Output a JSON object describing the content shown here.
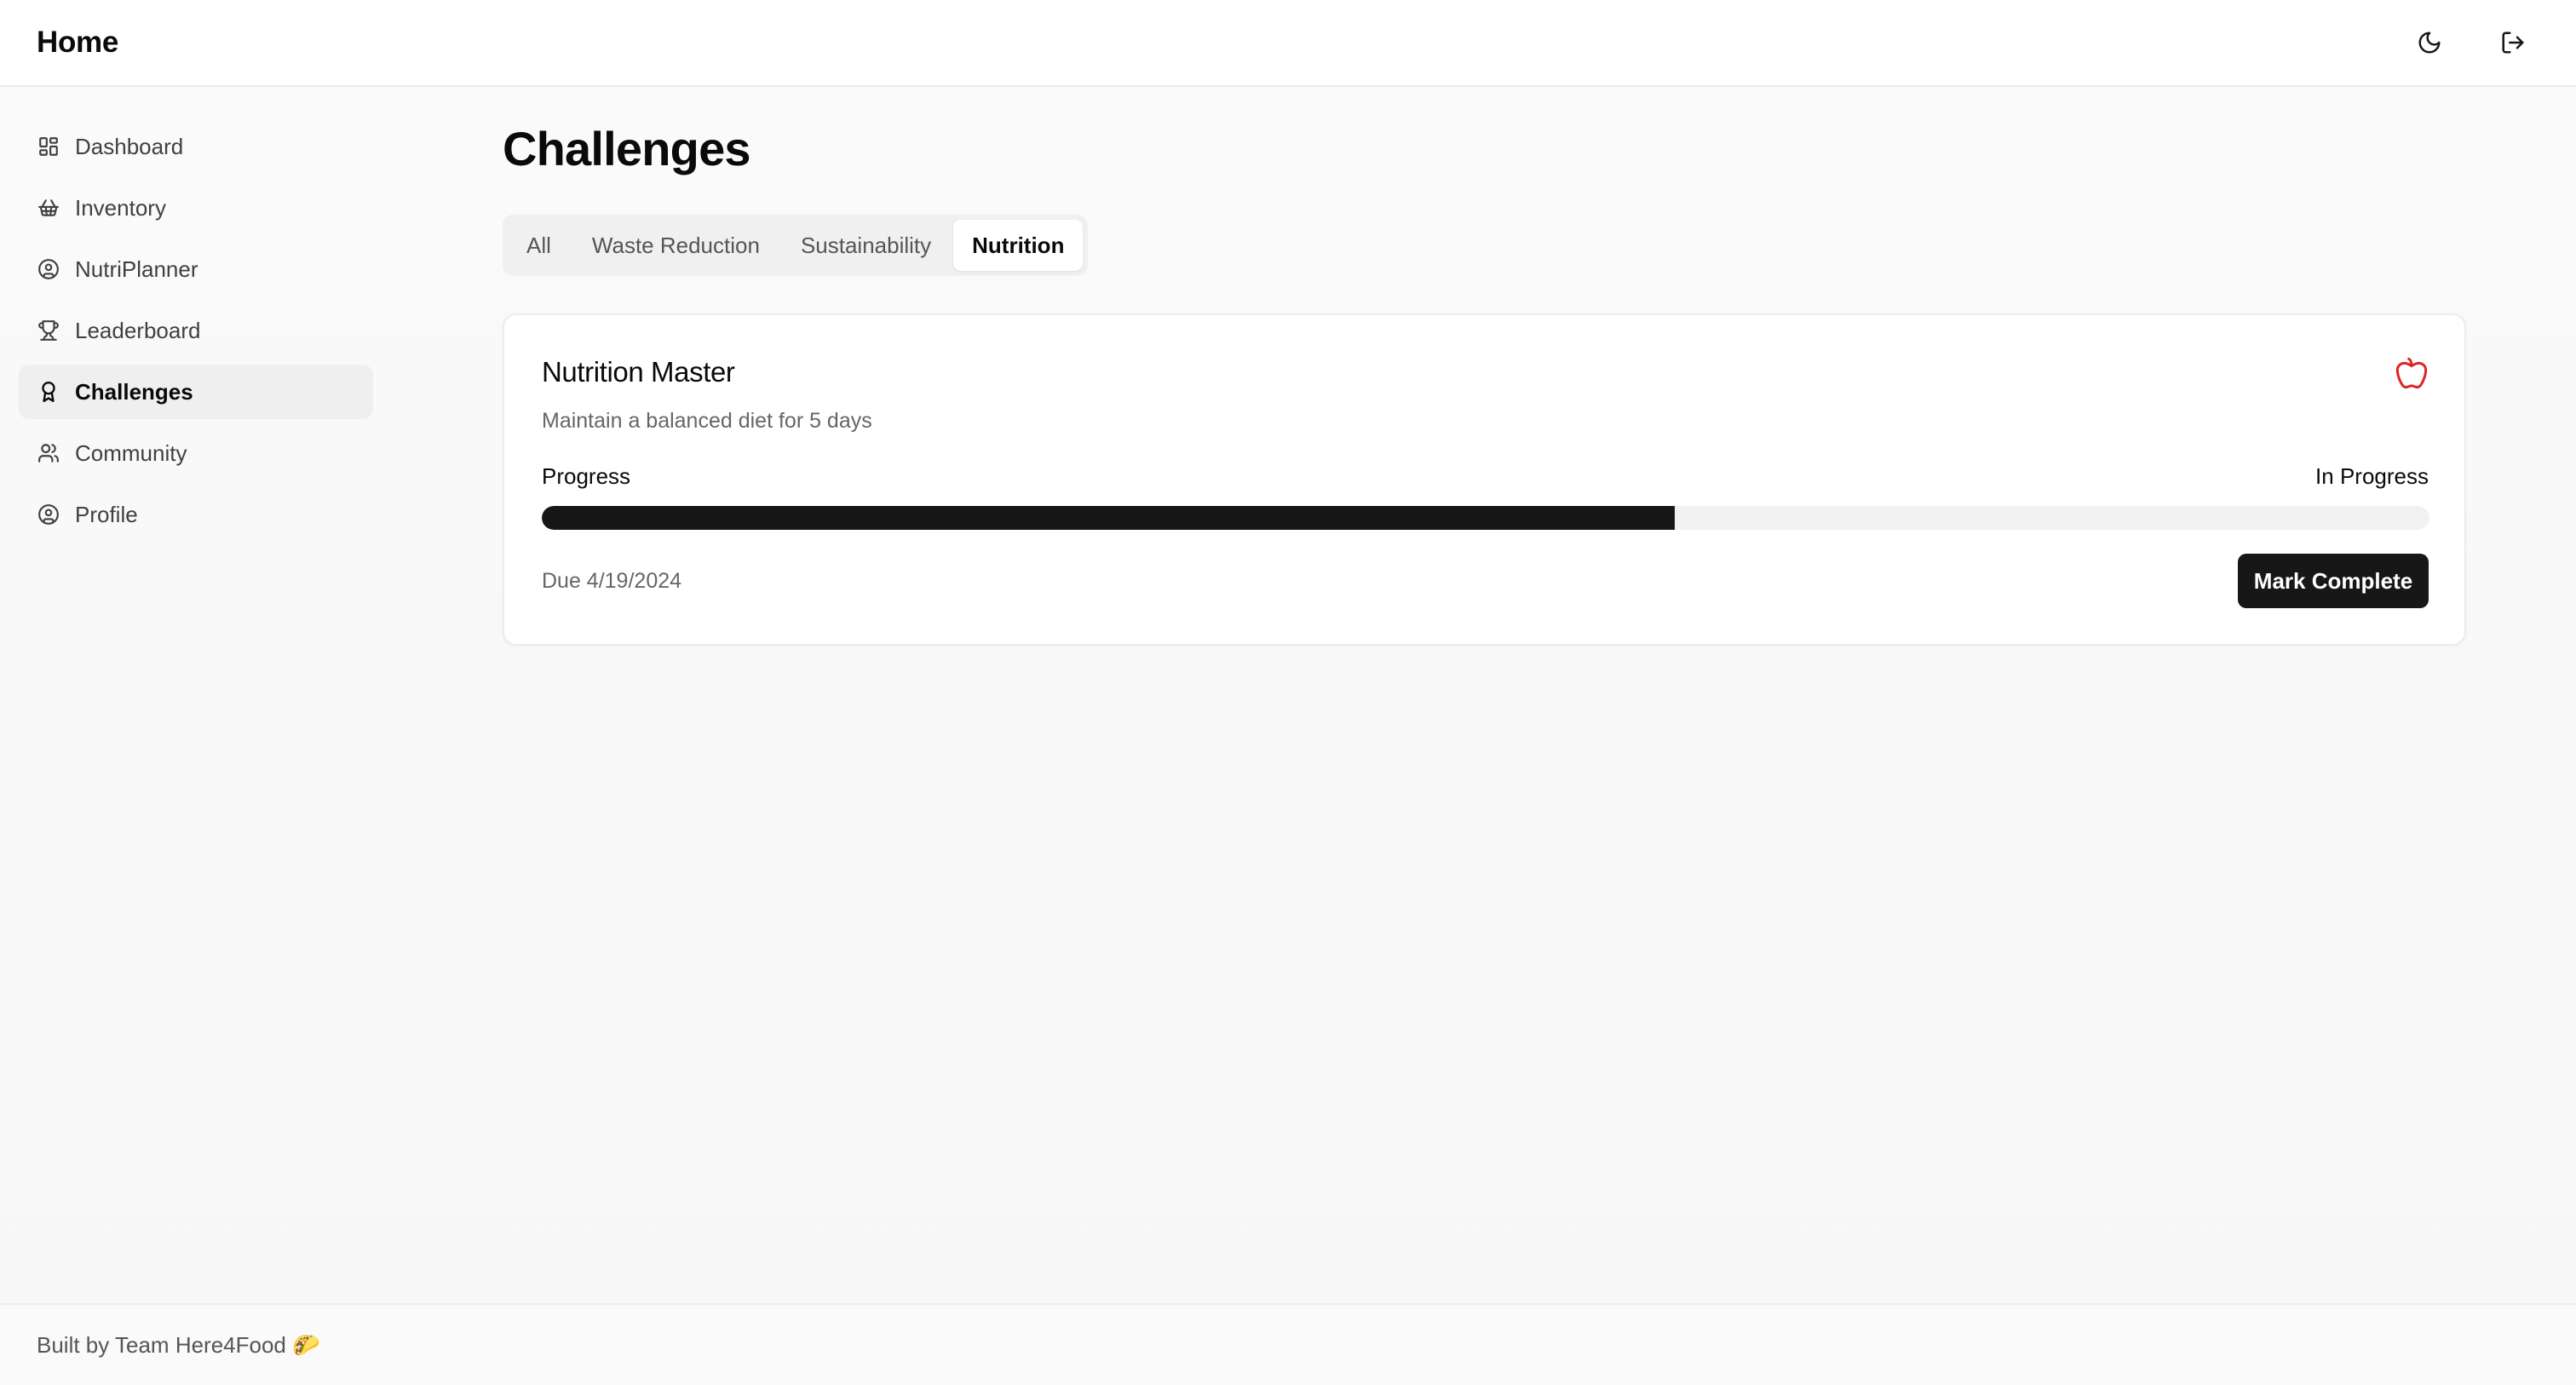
{
  "header": {
    "title": "Home",
    "theme_toggle_icon": "moon-icon",
    "logout_icon": "log-out-icon"
  },
  "sidebar": {
    "items": [
      {
        "label": "Dashboard",
        "icon": "layout-grid-icon",
        "active": false
      },
      {
        "label": "Inventory",
        "icon": "shopping-basket-icon",
        "active": false
      },
      {
        "label": "NutriPlanner",
        "icon": "user-circle-icon",
        "active": false
      },
      {
        "label": "Leaderboard",
        "icon": "trophy-icon",
        "active": false
      },
      {
        "label": "Challenges",
        "icon": "award-icon",
        "active": true
      },
      {
        "label": "Community",
        "icon": "users-icon",
        "active": false
      },
      {
        "label": "Profile",
        "icon": "user-circle-icon",
        "active": false
      }
    ]
  },
  "main": {
    "title": "Challenges",
    "tabs": [
      {
        "label": "All",
        "active": false
      },
      {
        "label": "Waste Reduction",
        "active": false
      },
      {
        "label": "Sustainability",
        "active": false
      },
      {
        "label": "Nutrition",
        "active": true
      }
    ],
    "challenge": {
      "title": "Nutrition Master",
      "description": "Maintain a balanced diet for 5 days",
      "icon": "apple-icon",
      "icon_color": "#dc2626",
      "progress_label": "Progress",
      "status": "In Progress",
      "progress_fraction": 0.6,
      "due": "Due 4/19/2024",
      "action_label": "Mark Complete"
    }
  },
  "footer": {
    "text": "Built by Team Here4Food 🌮"
  },
  "colors": {
    "accent": "#171717",
    "active_nav_bg": "#efefef",
    "track": "#f1f1f1"
  }
}
